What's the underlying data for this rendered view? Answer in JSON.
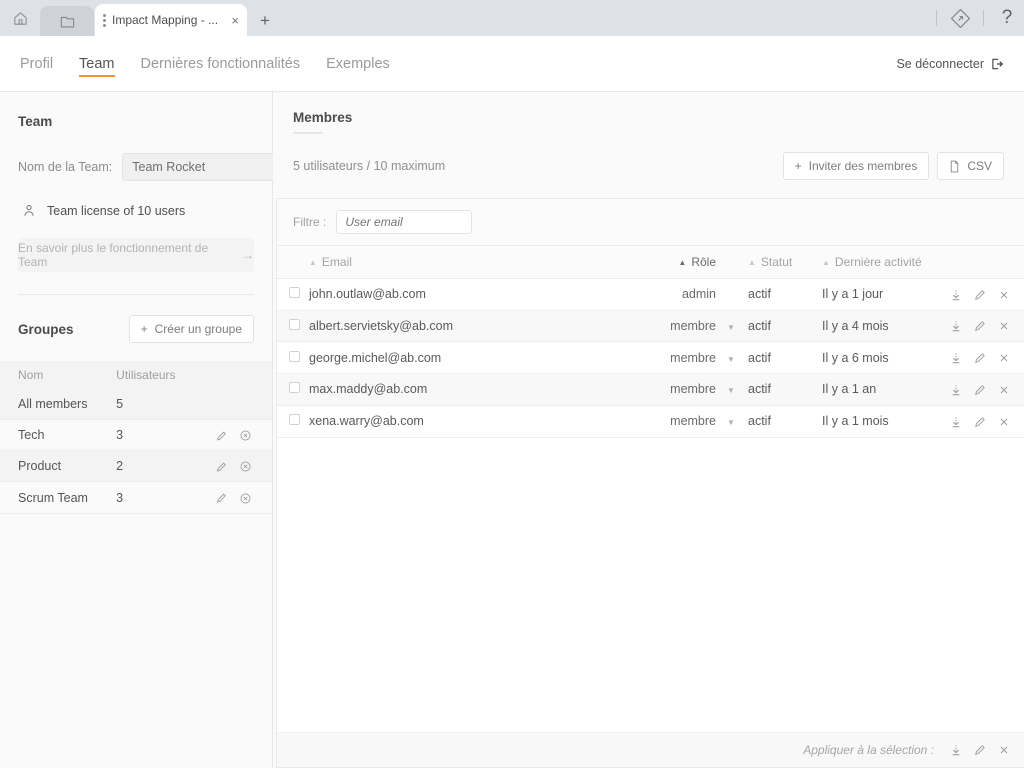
{
  "browser": {
    "home_icon": "home-icon",
    "folder_tab_icon": "folder-icon",
    "active_tab_title": "Impact Mapping - ...",
    "tab_close": "×",
    "new_tab": "+",
    "extension_icon": "diamond-extension-icon",
    "help_icon": "?"
  },
  "nav": {
    "items": [
      {
        "label": "Profil",
        "active": false
      },
      {
        "label": "Team",
        "active": true
      },
      {
        "label": "Dernières fonctionnalités",
        "active": false
      },
      {
        "label": "Exemples",
        "active": false
      }
    ],
    "logout_label": "Se déconnecter",
    "accent_color": "#f0903b"
  },
  "sidebar": {
    "team_title": "Team",
    "team_name_label": "Nom de la Team:",
    "team_name_value": "Team Rocket",
    "license_text": "Team license of 10 users",
    "learn_more_label": "En savoir plus le fonctionnement de Team",
    "learn_more_arrow": "→",
    "groups_title": "Groupes",
    "create_group_label": "Créer un groupe",
    "create_group_plus": "+",
    "groups_columns": [
      "Nom",
      "Utilisateurs"
    ],
    "groups": [
      {
        "name": "All members",
        "users": "5",
        "has_actions": false
      },
      {
        "name": "Tech",
        "users": "3",
        "has_actions": true
      },
      {
        "name": "Product",
        "users": "2",
        "has_actions": true
      },
      {
        "name": "Scrum Team",
        "users": "3",
        "has_actions": true
      }
    ]
  },
  "members": {
    "title": "Membres",
    "count_text": "5 utilisateurs / 10 maximum",
    "invite_label": "Inviter des membres",
    "invite_plus": "+",
    "csv_label": "CSV",
    "filter_label": "Filtre :",
    "filter_placeholder": "User email",
    "filter_value": "",
    "columns": [
      {
        "label": "Email",
        "sorted": false
      },
      {
        "label": "Rôle",
        "sorted": true
      },
      {
        "label": "Statut",
        "sorted": false
      },
      {
        "label": "Dernière activité",
        "sorted": false
      }
    ],
    "rows": [
      {
        "email": "john.outlaw@ab.com",
        "role": "admin",
        "role_dropdown": false,
        "status": "actif",
        "activity": "Il y a 1 jour",
        "checked": false
      },
      {
        "email": "albert.servietsky@ab.com",
        "role": "membre",
        "role_dropdown": true,
        "status": "actif",
        "activity": "Il y a 4 mois",
        "checked": false
      },
      {
        "email": "george.michel@ab.com",
        "role": "membre",
        "role_dropdown": true,
        "status": "actif",
        "activity": "Il y a 6 mois",
        "checked": false
      },
      {
        "email": "max.maddy@ab.com",
        "role": "membre",
        "role_dropdown": true,
        "status": "actif",
        "activity": "Il y a 1 an",
        "checked": false
      },
      {
        "email": "xena.warry@ab.com",
        "role": "membre",
        "role_dropdown": true,
        "status": "actif",
        "activity": "Il y a 1 mois",
        "checked": false
      }
    ],
    "footer_label": "Appliquer à la sélection :",
    "row_action_icons": [
      "download-icon",
      "edit-pencil-icon",
      "remove-x-icon"
    ]
  }
}
